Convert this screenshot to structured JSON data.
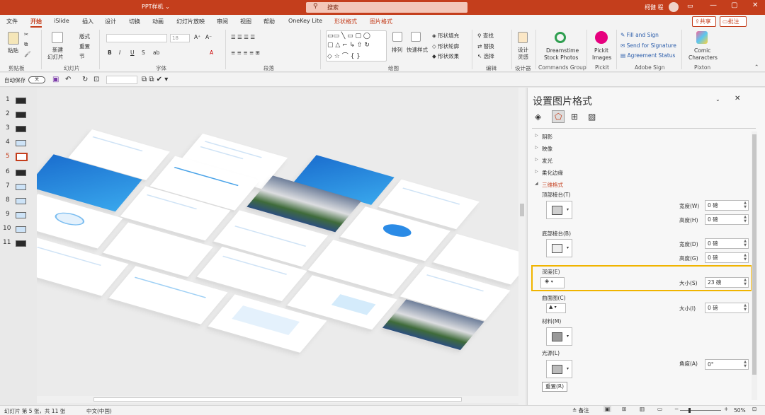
{
  "titlebar": {
    "doc": "PPT样机 ⌄",
    "search": "搜索",
    "user": "柯健 程",
    "min": "—",
    "max": "▢",
    "close": "✕"
  },
  "tabs": [
    "文件",
    "开始",
    "iSlide",
    "插入",
    "设计",
    "切换",
    "动画",
    "幻灯片放映",
    "审阅",
    "视图",
    "帮助",
    "OneKey Lite",
    "形状格式",
    "图片格式"
  ],
  "share": "共享",
  "comment": "批注",
  "ribbon": {
    "clipboard": {
      "paste": "粘贴",
      "label": "剪贴板"
    },
    "slides": {
      "new": "新建",
      "new2": "幻灯片",
      "layout": "版式",
      "reset": "重置",
      "section": "节",
      "label": "幻灯片"
    },
    "font": {
      "size": "18",
      "label": "字体",
      "bold": "B",
      "italic": "I",
      "underline": "U",
      "strike": "S",
      "color": "A"
    },
    "paragraph": {
      "label": "段落"
    },
    "drawing": {
      "arrange": "排列",
      "quick": "快速样式",
      "fill": "形状填充",
      "outline": "形状轮廓",
      "effect": "形状效果",
      "label": "绘图"
    },
    "editing": {
      "find": "查找",
      "replace": "替换",
      "select": "选择",
      "label": "编辑"
    },
    "designer": {
      "design": "设计",
      "idea": "灵感",
      "label": "设计器"
    },
    "dreamstime": {
      "l1": "Dreamstime",
      "l2": "Stock Photos",
      "label": "Commands Group"
    },
    "pickit": {
      "l1": "Pickit",
      "l2": "Images",
      "label": "Pickit"
    },
    "adobe": {
      "fill": "Fill and Sign",
      "send": "Send for Signature",
      "status": "Agreement Status",
      "label": "Adobe Sign"
    },
    "pixton": {
      "l1": "Comic",
      "l2": "Characters",
      "label": "Pixton"
    }
  },
  "qat": {
    "autosave": "自动保存",
    "toggle": "关"
  },
  "slides": [
    "1",
    "2",
    "3",
    "4",
    "5",
    "6",
    "7",
    "8",
    "9",
    "10",
    "11"
  ],
  "selected_slide": "5",
  "panel": {
    "title": "设置图片格式",
    "sections": [
      "阴影",
      "映像",
      "发光",
      "柔化边缘",
      "三维格式"
    ],
    "top_bevel": "顶部棱台(T)",
    "width_w": "宽度(W)",
    "height_h": "高度(H)",
    "bottom_bevel": "底部棱台(B)",
    "width_d": "宽度(D)",
    "height_g": "高度(G)",
    "depth": "深度(E)",
    "size_s": "大小(S)",
    "contour": "曲面图(C)",
    "size_i": "大小(I)",
    "material": "材料(M)",
    "lighting": "光源(L)",
    "angle": "角度(A)",
    "reset": "重置(R)",
    "val_w": "0 磅",
    "val_h": "0 磅",
    "val_d": "0 磅",
    "val_g": "0 磅",
    "val_s": "23 磅",
    "val_i": "0 磅",
    "val_a": "0°",
    "accent": "#e9a800"
  },
  "status": {
    "slide": "幻灯片 第 5 张，共 11 张",
    "lang": "中文(中国)",
    "notes": "备注",
    "zoom": "50%"
  },
  "colors": {
    "brand": "#c43e1c",
    "highlight": "#f0b400"
  }
}
